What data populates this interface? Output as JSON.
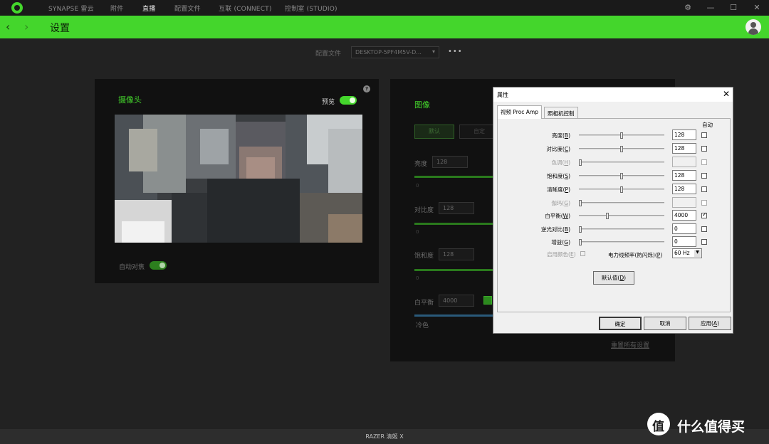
{
  "app": {
    "tabs": [
      {
        "label": "SYNAPSE 雷云",
        "active": false
      },
      {
        "label": "附件",
        "active": false
      },
      {
        "label": "直播",
        "active": true
      },
      {
        "label": "配置文件",
        "active": false
      },
      {
        "label": "互联 (CONNECT)",
        "active": false
      },
      {
        "label": "控制室 (STUDIO)",
        "active": false
      }
    ],
    "window_icons": [
      "gear-icon",
      "minimize-icon",
      "maximize-icon",
      "close-icon"
    ],
    "accent_color": "#44d62c"
  },
  "header": {
    "title": "设置",
    "back_icon": "chevron-left-icon",
    "forward_icon": "chevron-right-icon"
  },
  "profile": {
    "label": "配置文件",
    "value": "DESKTOP-5PF4M5V-D...",
    "more": "•••"
  },
  "camera_panel": {
    "title": "摄像头",
    "preview_label": "预览",
    "preview_on": true,
    "help": "?",
    "autofocus_label": "自动对焦",
    "autofocus_on": true
  },
  "image_panel": {
    "title": "图像",
    "btn1": "默认",
    "btn2": "自定",
    "sliders": [
      {
        "label": "亮度",
        "value": "128",
        "min": "0"
      },
      {
        "label": "对比度",
        "value": "128",
        "min": "0"
      },
      {
        "label": "饱和度",
        "value": "128",
        "min": "0"
      }
    ],
    "white_balance": {
      "label": "白平衡",
      "value": "4000",
      "auto": true
    },
    "cool_label": "冷色",
    "reset_link": "重置所有设置"
  },
  "dialog": {
    "title": "属性",
    "close": "✕",
    "tabs": [
      "视频 Proc Amp",
      "照相机控制"
    ],
    "auto_header": "自动",
    "properties": [
      {
        "label": "亮度(",
        "key": "B",
        "value": "128",
        "level": 0.5,
        "enabled": true,
        "auto": false
      },
      {
        "label": "对比度(",
        "key": "C",
        "value": "128",
        "level": 0.5,
        "enabled": true,
        "auto": false
      },
      {
        "label": "色调(",
        "key": "H",
        "value": "",
        "level": 0.0,
        "enabled": false,
        "auto": false
      },
      {
        "label": "饱和度(",
        "key": "S",
        "value": "128",
        "level": 0.5,
        "enabled": true,
        "auto": false
      },
      {
        "label": "清晰度(",
        "key": "P",
        "value": "128",
        "level": 0.5,
        "enabled": true,
        "auto": false
      },
      {
        "label": "伽玛(",
        "key": "G",
        "value": "",
        "level": 0.0,
        "enabled": false,
        "auto": false
      },
      {
        "label": "白平衡(",
        "key": "W",
        "value": "4000",
        "level": 0.33,
        "enabled": true,
        "auto": true
      },
      {
        "label": "逆光对比(",
        "key": "B",
        "value": "0",
        "level": 0.0,
        "enabled": true,
        "auto": false
      },
      {
        "label": "增益(",
        "key": "G",
        "value": "0",
        "level": 0.0,
        "enabled": true,
        "auto": false
      }
    ],
    "enable_color_label": "启用颜色(",
    "enable_color_key": "E",
    "powerline_label": "电力线频率(防闪烁)(",
    "powerline_key": "P",
    "powerline_value": "60 Hz",
    "default_btn": "默认值(",
    "default_key": "D",
    "ok_btn": "确定",
    "cancel_btn": "取消",
    "apply_btn": "应用(",
    "apply_key": "A"
  },
  "footer": {
    "text": "RAZER 清姬 X"
  },
  "watermark": {
    "text": "什么值得买"
  }
}
